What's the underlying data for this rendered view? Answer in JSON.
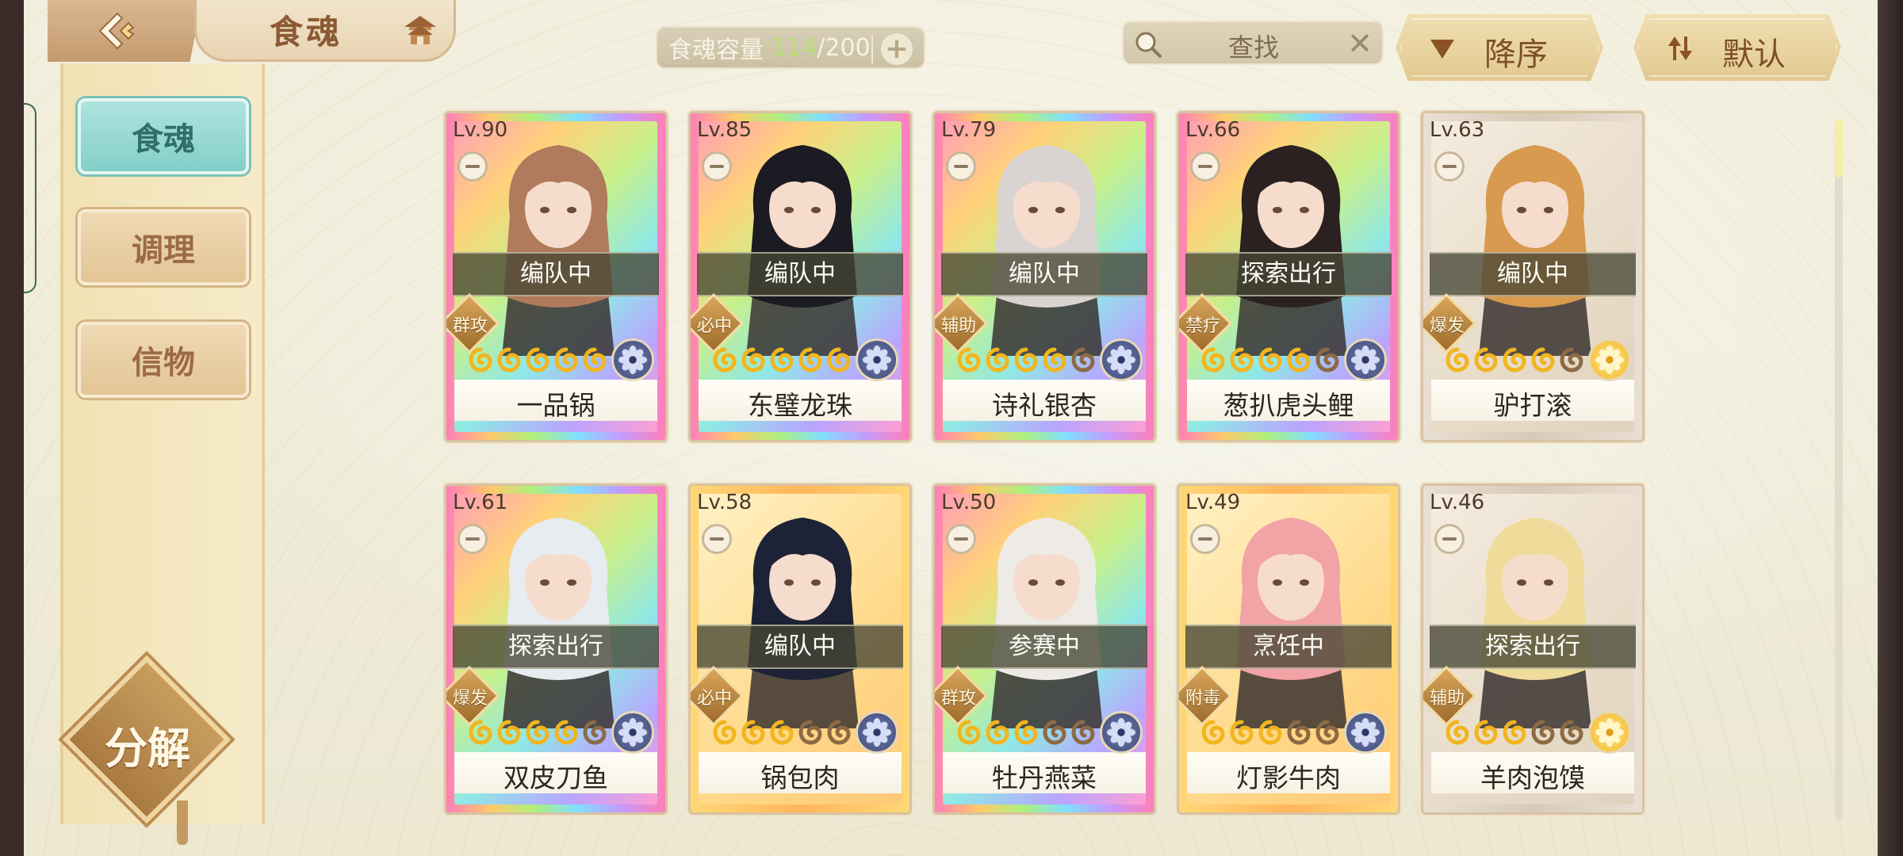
{
  "header": {
    "title": "食魂",
    "capacity": {
      "label": "食魂容量",
      "current": "114",
      "max": "/200"
    },
    "search": {
      "placeholder": "查找"
    },
    "sort_order": "降序",
    "sort_default": "默认"
  },
  "sidebar": {
    "tabs": [
      {
        "label": "食魂",
        "active": true
      },
      {
        "label": "调理",
        "active": false
      },
      {
        "label": "信物",
        "active": false
      }
    ],
    "decompose_label": "分解"
  },
  "cards": [
    {
      "level": "Lv.90",
      "status": "编队中",
      "role": "群攻",
      "name": "一品锅",
      "stars_filled": 5,
      "stars_total": 5,
      "frame": "rainbow",
      "attribute": "blue-flower-icon",
      "hair": "#b07a5c"
    },
    {
      "level": "Lv.85",
      "status": "编队中",
      "role": "必中",
      "name": "东璧龙珠",
      "stars_filled": 5,
      "stars_total": 5,
      "frame": "rainbow",
      "attribute": "blue-flower-icon",
      "hair": "#1c1a22"
    },
    {
      "level": "Lv.79",
      "status": "编队中",
      "role": "辅助",
      "name": "诗礼银杏",
      "stars_filled": 4,
      "stars_total": 5,
      "frame": "rainbow",
      "attribute": "blue-flower-icon",
      "hair": "#d9d4d2"
    },
    {
      "level": "Lv.66",
      "status": "探索出行",
      "role": "禁疗",
      "name": "葱扒虎头鲤",
      "stars_filled": 4,
      "stars_total": 5,
      "frame": "rainbow",
      "attribute": "blue-flower-icon",
      "hair": "#2a2120"
    },
    {
      "level": "Lv.63",
      "status": "编队中",
      "role": "爆发",
      "name": "驴打滚",
      "stars_filled": 4,
      "stars_total": 5,
      "frame": "silver",
      "attribute": "gold-flower-icon",
      "hair": "#d89a4f"
    },
    {
      "level": "Lv.61",
      "status": "探索出行",
      "role": "爆发",
      "name": "双皮刀鱼",
      "stars_filled": 4,
      "stars_total": 5,
      "frame": "rainbow",
      "attribute": "blue-flower-icon",
      "hair": "#e6ecf0"
    },
    {
      "level": "Lv.58",
      "status": "编队中",
      "role": "必中",
      "name": "锅包肉",
      "stars_filled": 3,
      "stars_total": 5,
      "frame": "gold",
      "attribute": "blue-flower-icon",
      "hair": "#1d2236"
    },
    {
      "level": "Lv.50",
      "status": "参赛中",
      "role": "群攻",
      "name": "牡丹燕菜",
      "stars_filled": 3,
      "stars_total": 5,
      "frame": "rainbow",
      "attribute": "blue-flower-icon",
      "hair": "#eeebe6"
    },
    {
      "level": "Lv.49",
      "status": "烹饪中",
      "role": "附毒",
      "name": "灯影牛肉",
      "stars_filled": 3,
      "stars_total": 5,
      "frame": "gold",
      "attribute": "blue-flower-icon",
      "hair": "#f2a3a6"
    },
    {
      "level": "Lv.46",
      "status": "探索出行",
      "role": "辅助",
      "name": "羊肉泡馍",
      "stars_filled": 3,
      "stars_total": 5,
      "frame": "silver",
      "attribute": "gold-flower-icon",
      "hair": "#f0dc9a"
    }
  ],
  "colors": {
    "accent_teal": "#83cfc9",
    "gold": "#e2c98f",
    "status_bg": "#46463a"
  }
}
